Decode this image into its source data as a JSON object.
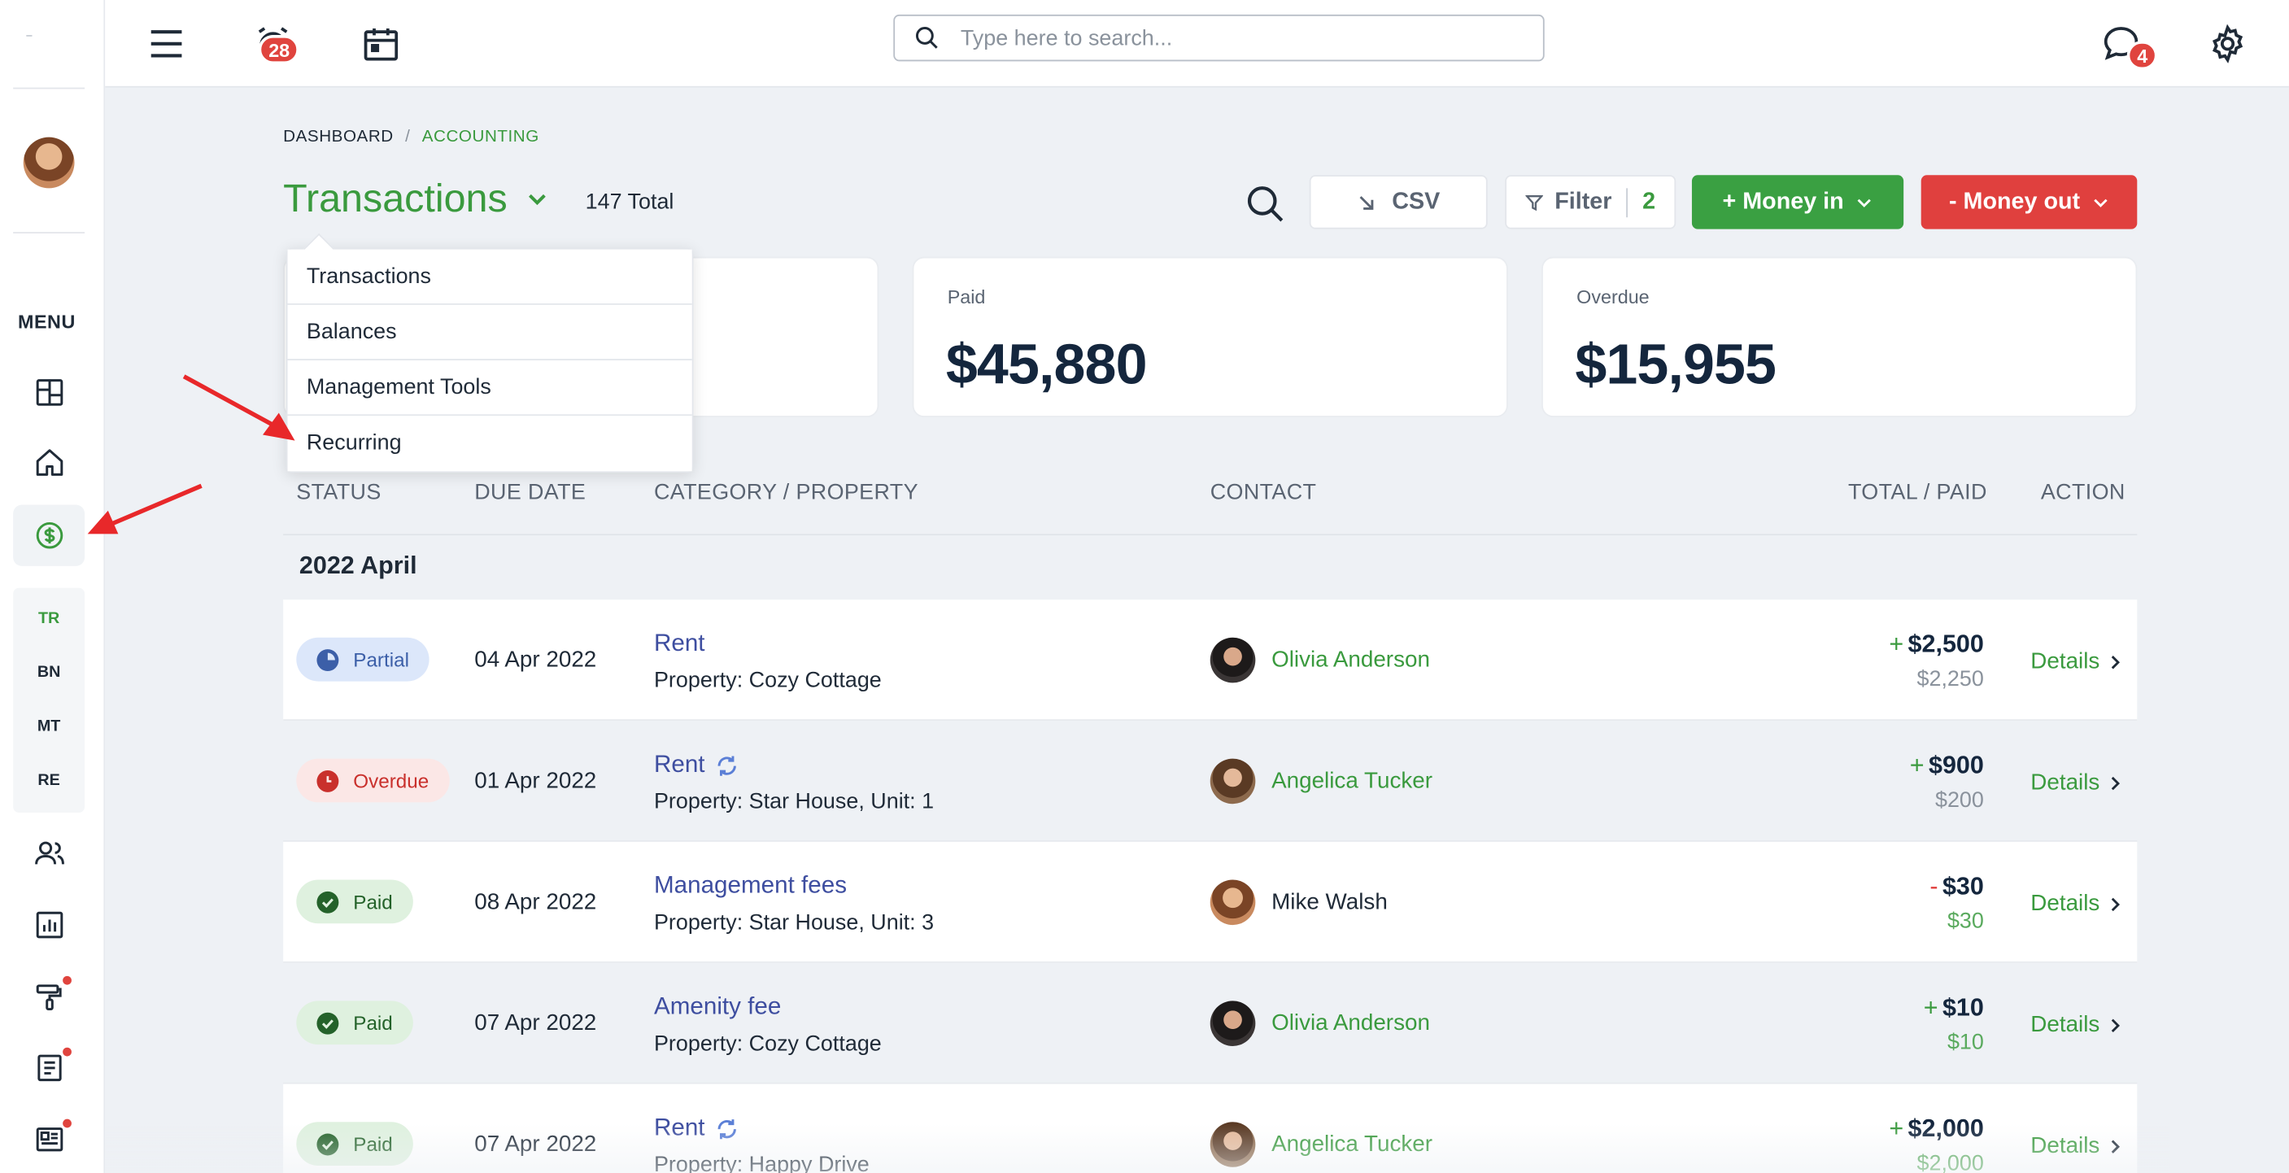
{
  "topbar": {
    "search_placeholder": "Type here to search...",
    "alerts_count": "28",
    "messages_count": "4"
  },
  "sidebar": {
    "menu_label": "MENU",
    "sub_items": [
      "TR",
      "BN",
      "MT",
      "RE"
    ]
  },
  "breadcrumb": {
    "home": "DASHBOARD",
    "separator": "/",
    "current": "ACCOUNTING"
  },
  "header": {
    "title": "Transactions",
    "total": "147 Total",
    "csv_label": "CSV",
    "filter_label": "Filter",
    "filter_count": "2",
    "money_in_label": "+ Money in",
    "money_out_label": "- Money out"
  },
  "dropdown": {
    "items": [
      "Transactions",
      "Balances",
      "Management Tools",
      "Recurring"
    ]
  },
  "cards": [
    {
      "label": "Paid",
      "value": "$45,880"
    },
    {
      "label": "Overdue",
      "value": "$15,955"
    }
  ],
  "table": {
    "columns": [
      "STATUS",
      "DUE DATE",
      "CATEGORY / PROPERTY",
      "CONTACT",
      "TOTAL / PAID",
      "ACTION"
    ],
    "group": "2022 April",
    "rows": [
      {
        "status": "Partial",
        "due": "04 Apr 2022",
        "category": "Rent",
        "property": "Property: Cozy Cottage",
        "contact": "Olivia Anderson",
        "sign": "+",
        "total": "$2,500",
        "paid": "$2,250",
        "action": "Details"
      },
      {
        "status": "Overdue",
        "due": "01 Apr 2022",
        "category": "Rent",
        "property": "Property: Star House, Unit: 1",
        "contact": "Angelica Tucker",
        "sign": "+",
        "total": "$900",
        "paid": "$200",
        "action": "Details"
      },
      {
        "status": "Paid",
        "due": "08 Apr 2022",
        "category": "Management fees",
        "property": "Property: Star House, Unit: 3",
        "contact": "Mike Walsh",
        "sign": "-",
        "total": "$30",
        "paid": "$30",
        "action": "Details"
      },
      {
        "status": "Paid",
        "due": "07 Apr 2022",
        "category": "Amenity fee",
        "property": "Property: Cozy Cottage",
        "contact": "Olivia Anderson",
        "sign": "+",
        "total": "$10",
        "paid": "$10",
        "action": "Details"
      },
      {
        "status": "Paid",
        "due": "07 Apr 2022",
        "category": "Rent",
        "property": "Property: Happy Drive",
        "contact": "Angelica Tucker",
        "sign": "+",
        "total": "$2,000",
        "paid": "$2,000",
        "action": "Details"
      }
    ]
  },
  "colors": {
    "brand_green": "#3a9a3e",
    "danger_red": "#e0403e",
    "link_blue": "#3e4ea0"
  }
}
